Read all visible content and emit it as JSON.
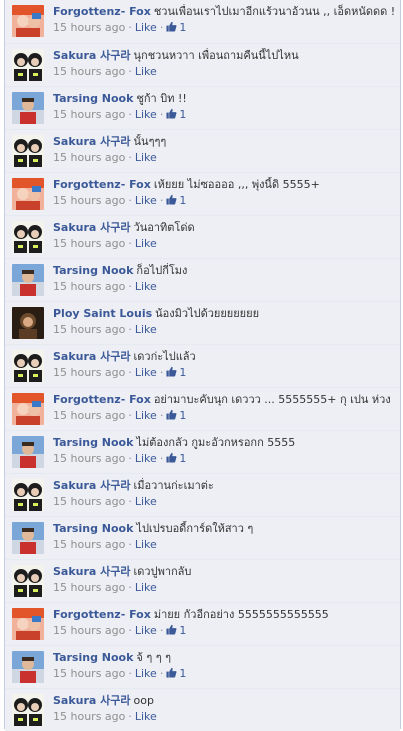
{
  "avatar_colors": {
    "fox": "#e2552b",
    "sakura": "#1d1d1d",
    "tarsing": "#7aa7d8",
    "ploy": "#6b4a2c"
  },
  "comments": [
    {
      "author": "Forgottenz- Fox",
      "avatar": "fox",
      "text": "ชวนเพื่อนเราไปเมาอีกแร้วนาอ้วนน ,, เอ็ดหนัดดด !!!",
      "time": "15 hours ago",
      "like_label": "Like",
      "likes": "1"
    },
    {
      "author": "Sakura 사구라",
      "avatar": "sakura",
      "text": "นุกชวนหวาา เพื่อนถามคืนนี้ไปไหน",
      "time": "15 hours ago",
      "like_label": "Like",
      "likes": ""
    },
    {
      "author": "Tarsing Nook",
      "avatar": "tarsing",
      "text": "ชูก้า บิท !!",
      "time": "15 hours ago",
      "like_label": "Like",
      "likes": "1"
    },
    {
      "author": "Sakura 사구라",
      "avatar": "sakura",
      "text": "นั้นๆๆๆ",
      "time": "15 hours ago",
      "like_label": "Like",
      "likes": ""
    },
    {
      "author": "Forgottenz- Fox",
      "avatar": "fox",
      "text": "เห้ยยย ไม่ซออออ ,,, พุ่งนี้ดิ 5555+",
      "time": "15 hours ago",
      "like_label": "Like",
      "likes": "1"
    },
    {
      "author": "Sakura 사구라",
      "avatar": "sakura",
      "text": "วันอาทิตโด่ด",
      "time": "15 hours ago",
      "like_label": "Like",
      "likes": ""
    },
    {
      "author": "Tarsing Nook",
      "avatar": "tarsing",
      "text": "ก็อไปกี่โมง",
      "time": "15 hours ago",
      "like_label": "Like",
      "likes": ""
    },
    {
      "author": "Ploy Saint Louis",
      "avatar": "ploy",
      "text": "น้องมิวไปด้วยยยยยยย",
      "time": "15 hours ago",
      "like_label": "Like",
      "likes": ""
    },
    {
      "author": "Sakura 사구라",
      "avatar": "sakura",
      "text": "เดวก่ะไปแล้ว",
      "time": "15 hours ago",
      "like_label": "Like",
      "likes": "1"
    },
    {
      "author": "Forgottenz- Fox",
      "avatar": "fox",
      "text": "อย่ามาบะคับนุก เดววว ... 5555555+ กุ เปน ห่วง",
      "time": "15 hours ago",
      "like_label": "Like",
      "likes": "1"
    },
    {
      "author": "Tarsing Nook",
      "avatar": "tarsing",
      "text": "ไม่ต้องกลัว กูมะอัวกหรอกก 5555",
      "time": "15 hours ago",
      "like_label": "Like",
      "likes": "1"
    },
    {
      "author": "Sakura 사구라",
      "avatar": "sakura",
      "text": "เมื่อวานก่ะเมาต่ะ",
      "time": "15 hours ago",
      "like_label": "Like",
      "likes": ""
    },
    {
      "author": "Tarsing Nook",
      "avatar": "tarsing",
      "text": "ไปเปรบอดี้การ์ดให้สาว ๆ",
      "time": "15 hours ago",
      "like_label": "Like",
      "likes": ""
    },
    {
      "author": "Sakura 사구라",
      "avatar": "sakura",
      "text": "เดวปูพากลับ",
      "time": "15 hours ago",
      "like_label": "Like",
      "likes": ""
    },
    {
      "author": "Forgottenz- Fox",
      "avatar": "fox",
      "text": "ม่ายย กัวอีกอย่าง 5555555555555",
      "time": "15 hours ago",
      "like_label": "Like",
      "likes": "1"
    },
    {
      "author": "Tarsing Nook",
      "avatar": "tarsing",
      "text": "จ้ ๆ ๆ ๆ",
      "time": "15 hours ago",
      "like_label": "Like",
      "likes": "1"
    },
    {
      "author": "Sakura 사구라",
      "avatar": "sakura",
      "text": "oop",
      "time": "15 hours ago",
      "like_label": "Like",
      "likes": ""
    }
  ]
}
